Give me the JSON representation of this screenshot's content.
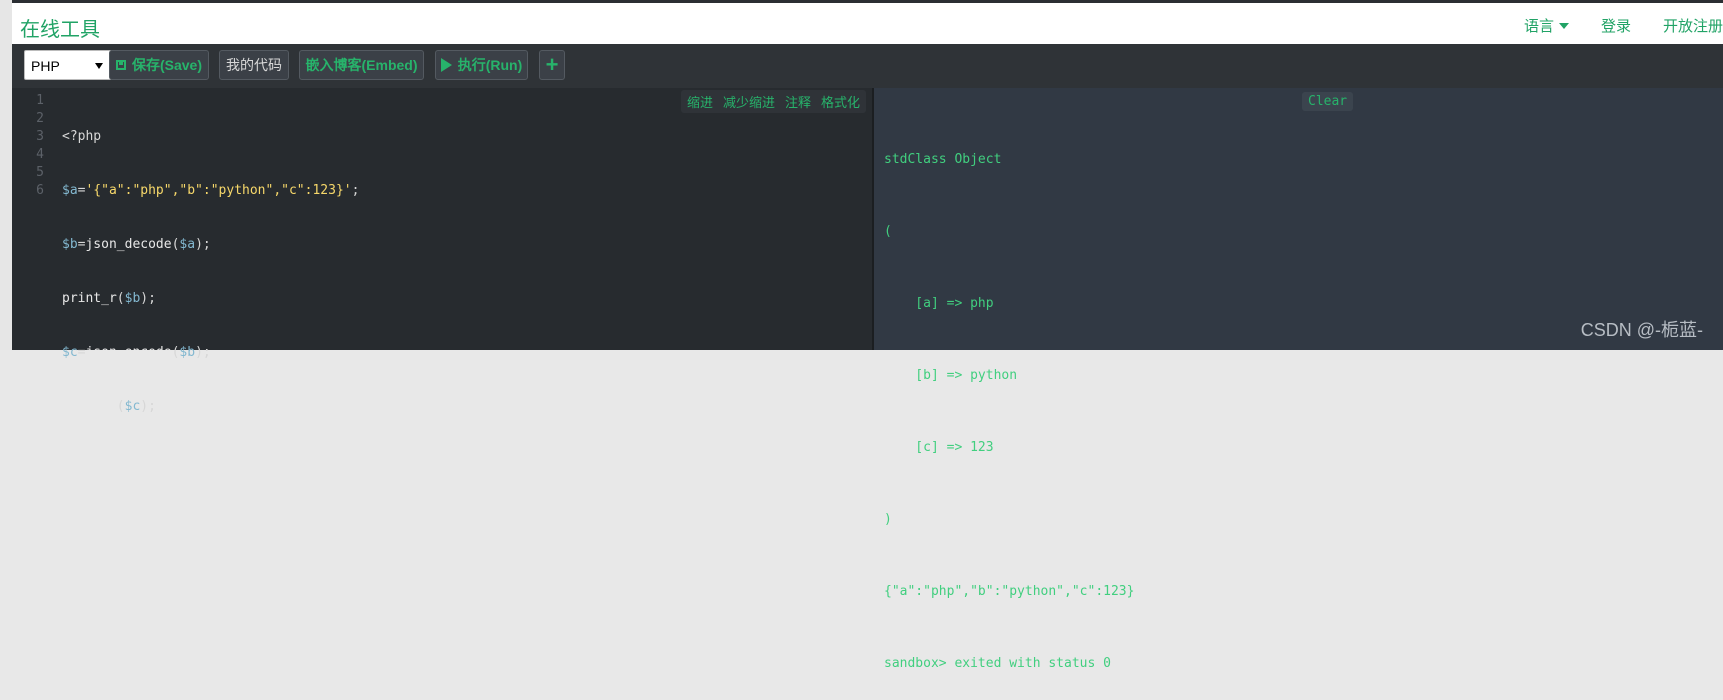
{
  "brand": "在线工具",
  "nav": {
    "language": "语言",
    "login": "登录",
    "register": "开放注册"
  },
  "toolbar": {
    "language_select": "PHP",
    "save": "保存(Save)",
    "my_code": "我的代码",
    "embed": "嵌入博客(Embed)",
    "run": "执行(Run)",
    "add": "+"
  },
  "editor": {
    "line_numbers": [
      "1",
      "2",
      "3",
      "4",
      "5",
      "6"
    ],
    "actions": [
      "缩进",
      "减少缩进",
      "注释",
      "格式化"
    ]
  },
  "output": {
    "clear": "Clear",
    "lines": [
      "stdClass Object",
      "(",
      "    [a] => php",
      "    [b] => python",
      "    [c] => 123",
      ")",
      "{\"a\":\"php\",\"b\":\"python\",\"c\":123}",
      "sandbox> exited with status 0"
    ]
  },
  "watermark": "CSDN @-栀蓝-"
}
